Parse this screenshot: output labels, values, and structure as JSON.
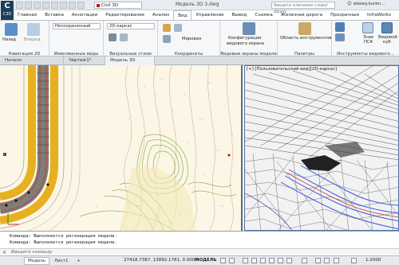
{
  "window": {
    "app_logo": "C3D",
    "workspace": "Civil 3D",
    "doc_title": "Модель 3D 3.dwg",
    "search_placeholder": "Введите ключевое слово/фразу",
    "user": "alexey.kuren..."
  },
  "ribbon_tabs": [
    "Главная",
    "Вставка",
    "Аннотации",
    "Редактирование",
    "Анализ",
    "Вид",
    "Управление",
    "Вывод",
    "Съемка",
    "Железная дорога",
    "Прозрачные",
    "InfraWorks"
  ],
  "active_ribbon_tab": "Вид",
  "ribbon": {
    "nav2d": {
      "back": "Назад",
      "forward": "Вперед",
      "label": "Навигация 2D"
    },
    "named_views": {
      "value": "Несохраненный",
      "label": "Именованные виды"
    },
    "visual_styles": {
      "value": "2D-каркас",
      "label": "Визуальные стили"
    },
    "coords": {
      "value": "Мировая",
      "label": "Координаты"
    },
    "viewports": {
      "config_line1": "Конфигурация",
      "config_line2": "видового экрана",
      "label": "Видовые экраны модели"
    },
    "palettes": {
      "tool_palettes": "Область инструментов",
      "label": "Палитры"
    },
    "viewport_tools": {
      "ucs_label_1": "Знак",
      "ucs_label_2": "ПСК",
      "vc_label_1": "Видовой",
      "vc_label_2": "куб",
      "label": "Инструменты видового..."
    }
  },
  "doc_tabs": [
    {
      "label": "Начало",
      "active": false
    },
    {
      "label": "Чертеж1*",
      "active": false
    },
    {
      "label": "Модель 3D 3*",
      "active": true
    }
  ],
  "viewport_right": {
    "label": "[+] [Пользовательский вид][2D-каркас]"
  },
  "command": {
    "lines": [
      "Команда:  Выполняется регенерация модели.",
      "Команда:  Выполняется регенерация модели."
    ],
    "prompt": "Введите команду"
  },
  "status": {
    "layout_tabs": [
      "Модель",
      "Лист1",
      "+"
    ],
    "coords": "27418.7387, 13892.1781, 0.0000",
    "model": "МОДЕЛЬ",
    "scale": "1:2000"
  },
  "colors": {
    "road_yellow": "#e8b020",
    "contour_green": "#7aa83a",
    "wire_blue": "#3a5adf"
  }
}
